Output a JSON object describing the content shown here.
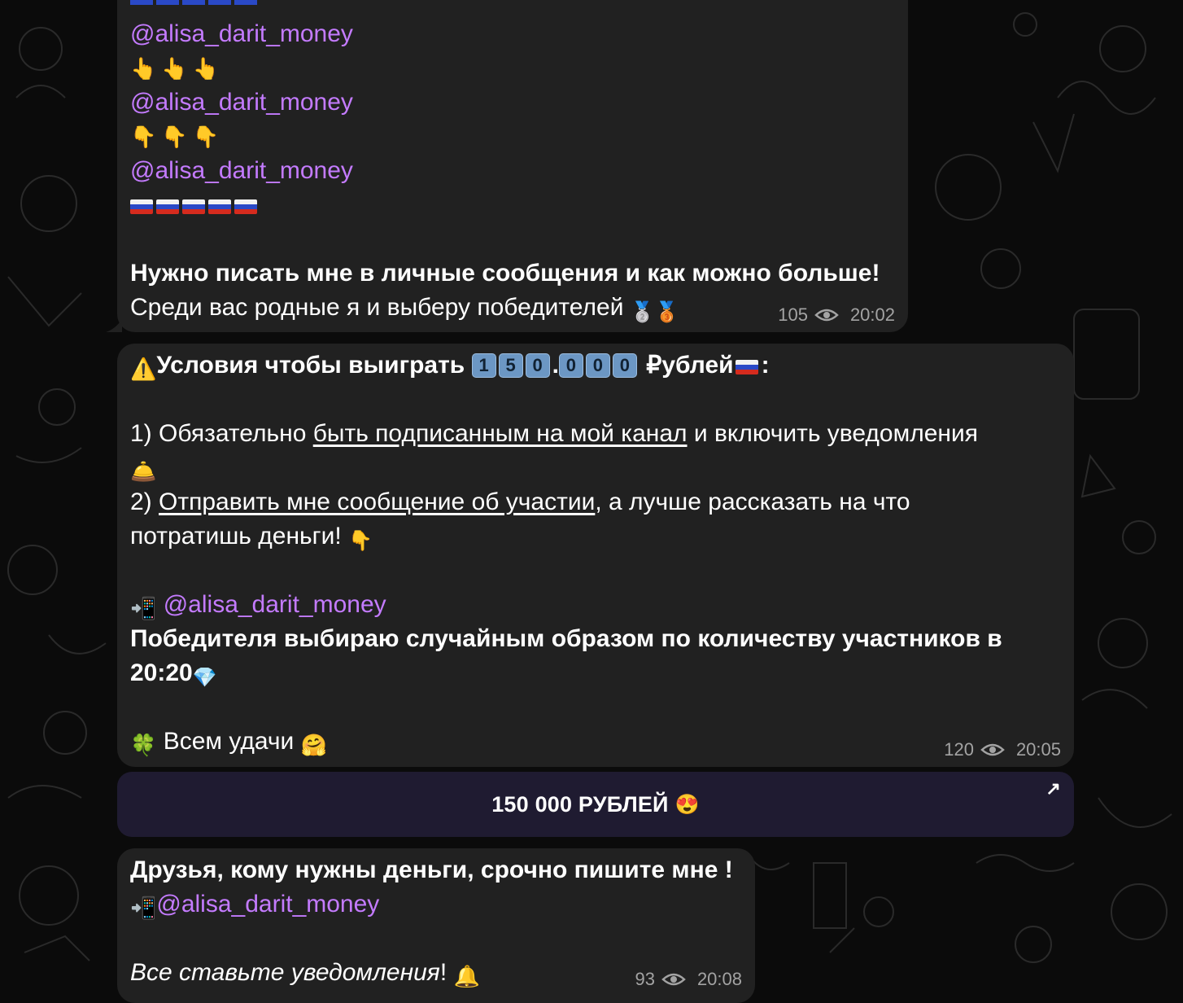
{
  "message1": {
    "mention_1": "@alisa_darit_money",
    "mention_2": "@alisa_darit_money",
    "mention_3": "@alisa_darit_money",
    "line_bold": "Нужно писать мне в личные сообщения и как можно больше!",
    "line_last": "Среди вас родные я и выберу победителей",
    "views": "105",
    "time": "20:02"
  },
  "message2": {
    "title_text": "Условия чтобы выиграть",
    "title_digits_a": [
      "1",
      "5",
      "0"
    ],
    "title_digits_b": [
      "0",
      "0",
      "0"
    ],
    "title_dot": ".",
    "title_currency": "₽ублей",
    "title_colon": ":",
    "cond1_prefix": "1) Обязательно ",
    "cond1_link": "быть подписанным на мой канал",
    "cond1_suffix": " и включить уведомления",
    "cond2_prefix": "2) ",
    "cond2_link": "Отправить мне сообщение об участии",
    "cond2_suffix": ", а лучше рассказать на что",
    "cond2_line2": "потратишь деньги!",
    "mention": "@alisa_darit_money",
    "winner_line1": "Победителя выбираю случайным образом по количеству участников в",
    "winner_line2": "20:20",
    "luck": "Всем удачи",
    "views": "120",
    "time": "20:05"
  },
  "post_button": {
    "label": "150 000 РУБЛЕЙ",
    "emoji": "😍",
    "arrow": "↗"
  },
  "message3": {
    "line1": "Друзья, кому нужны деньги, срочно пишите мне !",
    "mention": "@alisa_darit_money",
    "line3_italic": "Все ставьте уведомления",
    "line3_tail": "!",
    "views": "93",
    "time": "20:08"
  },
  "emojis": {
    "point_up": "👆",
    "point_down": "👇",
    "medal_2": "🥈",
    "medal_3": "🥉",
    "warning": "⚠️",
    "bell": "🛎️",
    "phone": "📲",
    "diamond": "💎",
    "clover": "🍀",
    "hug": "🤗",
    "bell2": "🔔"
  },
  "colors": {
    "background": "#0b0b0b",
    "bubble": "#212121",
    "mention": "#c47bff",
    "meta": "#a3a3a3"
  }
}
